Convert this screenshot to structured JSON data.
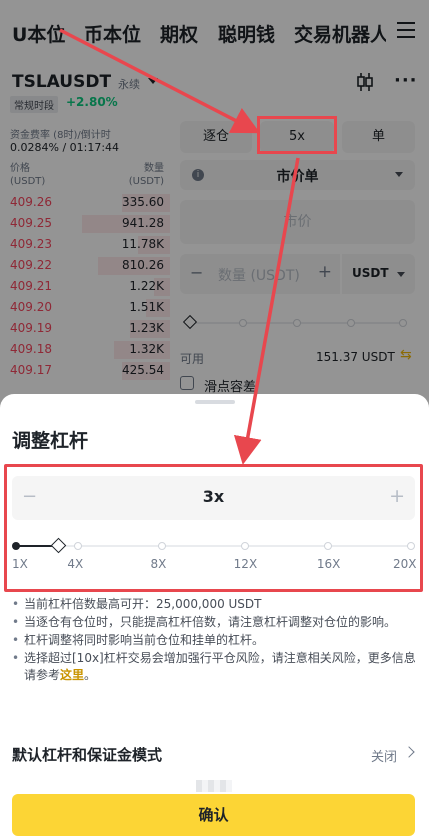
{
  "top_tabs": [
    "U本位",
    "币本位",
    "期权",
    "聪明钱",
    "交易机器人"
  ],
  "header": {
    "symbol": "TSLAUSDT",
    "perp_tag": "永续",
    "session_badge": "常规时段",
    "change": "+2.80%",
    "funding_label": "资金费率 (8时)/倒计时",
    "funding_value": "0.0284% / 01:17:44",
    "icons": [
      "candlestick-chart-icon",
      "more-icon",
      "menu-icon"
    ]
  },
  "orderbook": {
    "price_head": [
      "价格",
      "(USDT)"
    ],
    "qty_head": [
      "数量",
      "(USDT)"
    ],
    "rows": [
      {
        "price": "409.26",
        "qty": "335.60",
        "depth": 0.3
      },
      {
        "price": "409.25",
        "qty": "941.28",
        "depth": 0.55
      },
      {
        "price": "409.23",
        "qty": "11.78K",
        "depth": 0.2
      },
      {
        "price": "409.22",
        "qty": "810.26",
        "depth": 0.45
      },
      {
        "price": "409.21",
        "qty": "1.22K",
        "depth": 0.1
      },
      {
        "price": "409.20",
        "qty": "1.51K",
        "depth": 0.15
      },
      {
        "price": "409.19",
        "qty": "1.23K",
        "depth": 0.25
      },
      {
        "price": "409.18",
        "qty": "1.32K",
        "depth": 0.35
      },
      {
        "price": "409.17",
        "qty": "425.54",
        "depth": 0.3
      }
    ]
  },
  "order_form": {
    "margin_mode": "逐仓",
    "leverage": "5x",
    "position_mode": "单",
    "order_type": "市价单",
    "price_placeholder": "市价",
    "qty_placeholder": "数量 (USDT)",
    "unit": "USDT",
    "available_label": "可用",
    "available_value": "151.37 USDT",
    "slippage_label": "滑点容差"
  },
  "sheet": {
    "title": "调整杠杆",
    "value": "3x",
    "minus": "−",
    "plus": "+",
    "slider": {
      "min": 1,
      "max": 20,
      "current": 3,
      "marks": [
        {
          "label": "1X",
          "value": 1
        },
        {
          "label": "4X",
          "value": 4
        },
        {
          "label": "8X",
          "value": 8
        },
        {
          "label": "12X",
          "value": 12
        },
        {
          "label": "16X",
          "value": 16
        },
        {
          "label": "20X",
          "value": 20
        }
      ]
    },
    "notes": {
      "n1": "当前杠杆倍数最高可开：25,000,000 USDT",
      "n2": "当逐仓有仓位时，只能提高杠杆倍数，请注意杠杆调整对仓位的影响。",
      "n3": "杠杆调整将同时影响当前仓位和挂单的杠杆。",
      "n4_text": "选择超过[10x]杠杆交易会增加强行平仓风险，请注意相关风险，更多信息请参考",
      "n4_link": "这里",
      "n4_end": "。"
    },
    "default_label": "默认杠杆和保证金模式",
    "default_value": "关闭",
    "confirm": "确认"
  },
  "colors": {
    "annotation": "#e8474e",
    "accent": "#fcd535",
    "ask": "#f6465d",
    "bid": "#0ecb81"
  }
}
